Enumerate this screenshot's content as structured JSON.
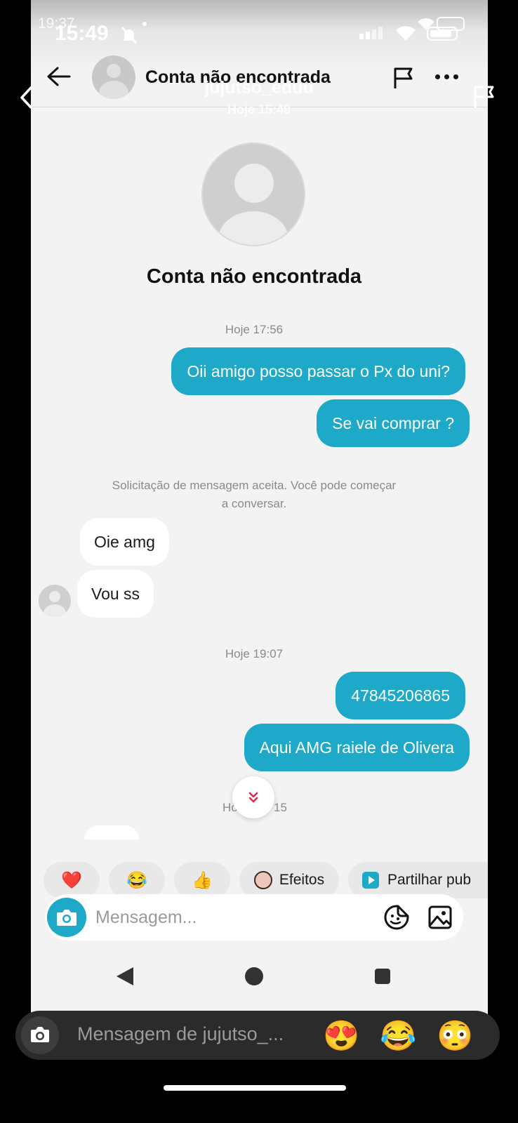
{
  "outer_status": {
    "time_small": "19:37",
    "time": "15:49"
  },
  "story": {
    "username": "jujutso_eduu",
    "timestamp": "Hoje 15:49"
  },
  "chat_header": {
    "title": "Conta não encontrada"
  },
  "profile": {
    "name": "Conta não encontrada"
  },
  "messages": [
    {
      "type": "timestamp",
      "text": "Hoje 17:56"
    },
    {
      "type": "out",
      "text": "Oii amigo posso passar o Px do uni?"
    },
    {
      "type": "out",
      "text": "Se vai comprar ?"
    },
    {
      "type": "system",
      "text_line1": "Solicitação de mensagem aceita. Você pode começar",
      "text_line2": "a conversar."
    },
    {
      "type": "in",
      "text": "Oie amg"
    },
    {
      "type": "in",
      "text": "Vou ss"
    },
    {
      "type": "timestamp",
      "text": "Hoje 19:07"
    },
    {
      "type": "out",
      "text": "47845206865"
    },
    {
      "type": "out",
      "text": "Aqui AMG raiele de Olivera"
    },
    {
      "type": "timestamp_partial",
      "left": "Ho",
      "right": "15"
    }
  ],
  "quick_replies": {
    "heart": "❤️",
    "laugh": "😂",
    "thumbs": "👍",
    "effects_label": "Efeitos",
    "share_label": "Partilhar pub"
  },
  "composer": {
    "placeholder": "Mensagem..."
  },
  "story_reply": {
    "placeholder": "Mensagem de jujutso_...",
    "emoji1": "😍",
    "emoji2": "😂",
    "emoji3": "😳"
  },
  "colors": {
    "accent": "#1ea9c8",
    "background": "#f3f3f3",
    "incoming_bubble": "#ffffff"
  }
}
